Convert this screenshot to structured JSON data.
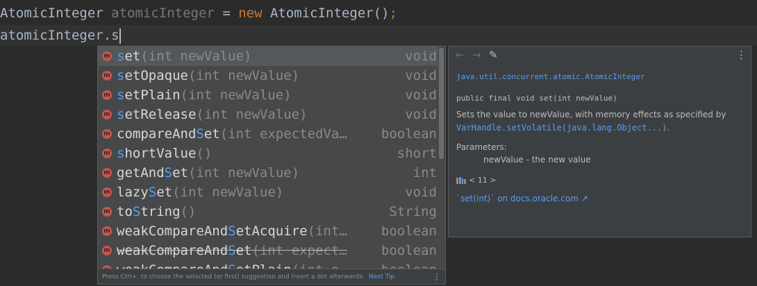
{
  "editor": {
    "line1": {
      "type_name": "AtomicInteger ",
      "var_name": "atomicInteger",
      "eq": " = ",
      "new_kw": "new",
      "constructor": " AtomicInteger()",
      "semicolon": ";"
    },
    "line2": {
      "text": "atomicInteger.s"
    }
  },
  "completion": {
    "items": [
      {
        "pre": "",
        "hl": "s",
        "post": "et",
        "params": "(int newValue)",
        "ret": "void"
      },
      {
        "pre": "",
        "hl": "s",
        "post": "etOpaque",
        "params": "(int newValue)",
        "ret": "void"
      },
      {
        "pre": "",
        "hl": "s",
        "post": "etPlain",
        "params": "(int newValue)",
        "ret": "void"
      },
      {
        "pre": "",
        "hl": "s",
        "post": "etRelease",
        "params": "(int newValue)",
        "ret": "void"
      },
      {
        "pre": "compareAnd",
        "hl": "S",
        "post": "et",
        "params": "(int expectedVa…",
        "ret": "boolean"
      },
      {
        "pre": "",
        "hl": "s",
        "post": "hortValue",
        "params": "()",
        "ret": "short"
      },
      {
        "pre": "getAnd",
        "hl": "S",
        "post": "et",
        "params": "(int newValue)",
        "ret": "int"
      },
      {
        "pre": "lazy",
        "hl": "S",
        "post": "et",
        "params": "(int newValue)",
        "ret": "void"
      },
      {
        "pre": "to",
        "hl": "S",
        "post": "tring",
        "params": "()",
        "ret": "String"
      },
      {
        "pre": "weakCompareAnd",
        "hl": "S",
        "post": "etAcquire",
        "params": "(int…",
        "ret": "boolean"
      },
      {
        "pre": "weakCompareAnd",
        "hl": "S",
        "post": "et",
        "params": "(int expect…",
        "ret": "boolean"
      },
      {
        "pre": "weakCompareAnd",
        "hl": "S",
        "post": "etPlain",
        "params": "(int e…",
        "ret": "boolean"
      }
    ],
    "method_icon": "m",
    "footer": {
      "hint": "Press Ctrl+. to choose the selected (or first) suggestion and insert a dot afterwards",
      "next_tip": "Next Tip",
      "kebab": "⋮"
    }
  },
  "doc": {
    "toolbar": {
      "back": "←",
      "forward": "→",
      "edit": "✎",
      "kebab": "⋮"
    },
    "class_name": "java.util.concurrent.atomic.AtomicInteger",
    "signature": "public final void set(int newValue)",
    "desc_line1": "Sets the value to newValue, with memory effects as specified by",
    "desc_link": "VarHandle.setVolatile(java.lang.Object...)",
    "desc_period": ".",
    "params_label": "Parameters:",
    "param_line": "newValue - the new value",
    "version": "< 11 >",
    "external_link": "`set(int)` on docs.oracle.com ↗"
  },
  "colors": {
    "background": "#2b2b2b",
    "popup": "#46484a",
    "highlight": "#589df6",
    "keyword": "#cc7832",
    "method_icon": "#c75450"
  }
}
